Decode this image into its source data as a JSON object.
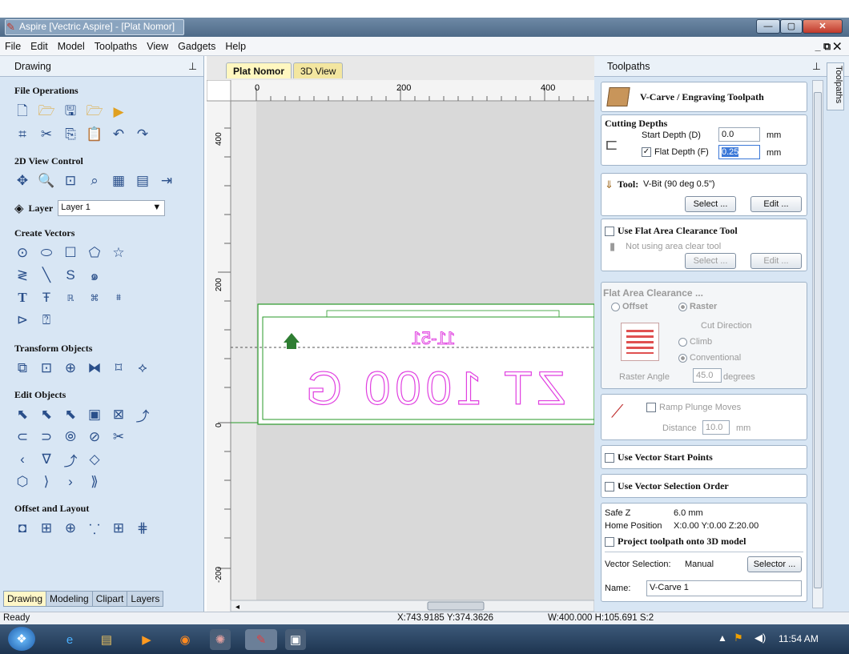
{
  "window": {
    "title": "Aspire [Vectric Aspire] - [Plat Nomor]"
  },
  "menu": [
    "File",
    "Edit",
    "Model",
    "Toolpaths",
    "View",
    "Gadgets",
    "Help"
  ],
  "left": {
    "panel_title": "Drawing",
    "sections": {
      "file_ops": "File Operations",
      "view2d": "2D View Control",
      "layer_label": "Layer",
      "layer_value": "Layer 1",
      "create_vectors": "Create Vectors",
      "transform": "Transform Objects",
      "edit": "Edit Objects",
      "offset": "Offset and Layout"
    },
    "tabs": [
      "Drawing",
      "Modeling",
      "Clipart",
      "Layers"
    ]
  },
  "center": {
    "tabs": [
      "Plat Nomor",
      "3D View"
    ],
    "ruler_x": [
      "0",
      "200",
      "400"
    ],
    "ruler_y": [
      "400",
      "200",
      "0",
      "-200"
    ],
    "plate_top_text": "11-51",
    "plate_main_text": "ZT 1000 G"
  },
  "right": {
    "panel_title": "Toolpaths",
    "side_tab": "Toolpaths",
    "header": "V-Carve / Engraving Toolpath",
    "cutting": {
      "title": "Cutting Depths",
      "start_label": "Start Depth (D)",
      "start_value": "0.0",
      "flat_label": "Flat Depth (F)",
      "flat_value": "0.25",
      "unit": "mm"
    },
    "tool": {
      "label": "Tool:",
      "value": "V-Bit (90 deg 0.5\")",
      "select": "Select ...",
      "edit": "Edit ..."
    },
    "flat_clear": {
      "title": "Use Flat Area Clearance Tool",
      "note": "Not using area clear tool",
      "select": "Select ...",
      "edit": "Edit ..."
    },
    "fac": {
      "title": "Flat Area Clearance ...",
      "offset": "Offset",
      "raster": "Raster",
      "cut_dir": "Cut Direction",
      "climb": "Climb",
      "conventional": "Conventional",
      "raster_angle_label": "Raster Angle",
      "raster_angle": "45.0",
      "degrees": "degrees"
    },
    "ramp": {
      "label": "Ramp Plunge Moves",
      "distance_label": "Distance",
      "distance": "10.0",
      "unit": "mm"
    },
    "start_points": "Use Vector Start Points",
    "selection_order": "Use Vector Selection Order",
    "safe": {
      "safe_z_label": "Safe Z",
      "safe_z": "6.0 mm",
      "home_label": "Home Position",
      "home": "X:0.00 Y:0.00 Z:20.00",
      "project": "Project toolpath onto 3D model",
      "vec_sel_label": "Vector Selection:",
      "vec_sel": "Manual",
      "selector": "Selector ...",
      "name_label": "Name:",
      "name": "V-Carve 1"
    }
  },
  "status": {
    "ready": "Ready",
    "coords": "X:743.9185 Y:374.3626",
    "size": "W:400.000  H:105.691  S:2"
  },
  "taskbar": {
    "time": "11:54 AM"
  }
}
